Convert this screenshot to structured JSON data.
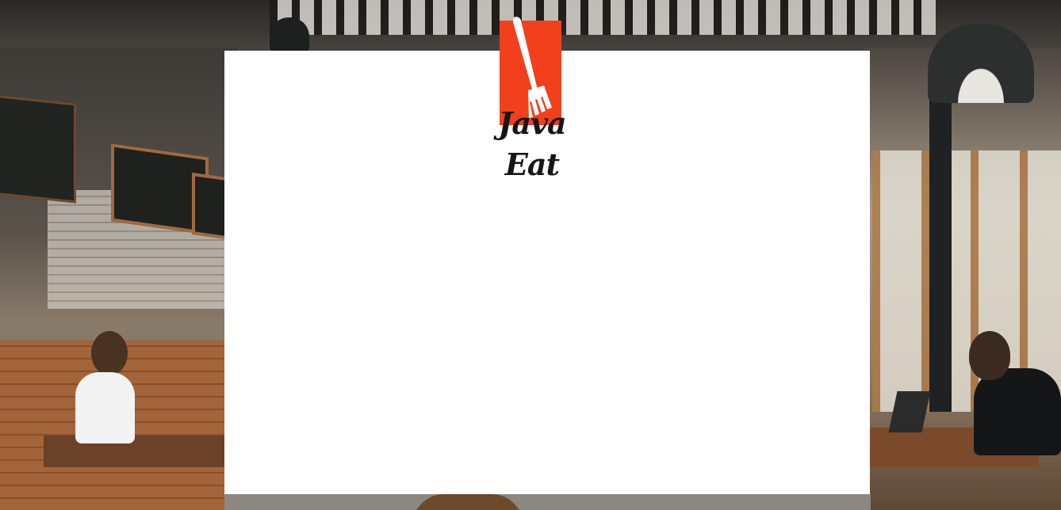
{
  "brand": {
    "name": "Java Eat",
    "accent_color": "#f2401c",
    "logo_icon": "fork-icon"
  },
  "background": {
    "description_icon": "cafe-background-photo"
  },
  "panel": {
    "background_color": "#ffffff"
  }
}
